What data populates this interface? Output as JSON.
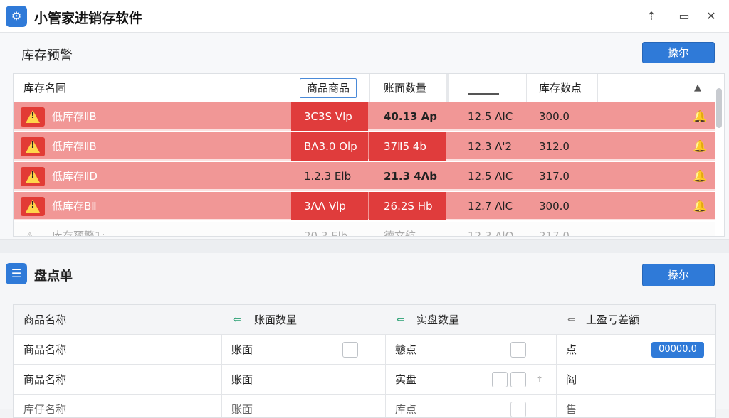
{
  "app": {
    "title": "小管家进销存软件",
    "icon": "app-logo-icon"
  },
  "window_controls": [
    "pin-icon",
    "restore-icon",
    "close-icon"
  ],
  "alert_panel": {
    "title": "库存预警",
    "button_label": "搡尔",
    "columns": [
      "库存名固",
      "商品商品",
      "账面数量",
      "库存数点"
    ],
    "rows": [
      {
        "name": "低库存ⅡB",
        "c1": "3C3S Vlp",
        "c2": "40.13 Ap",
        "c3": "12.5 ΛIC",
        "c4": "300.0"
      },
      {
        "name": "低库存ⅡB",
        "c1": "BΛ3.0 Olp",
        "c2": "37Ⅱ5 4b",
        "c3": "12.3 Λ'2",
        "c4": "312.0"
      },
      {
        "name": "低库存ⅡD",
        "c1": "1.2.3 Elb",
        "c2": "21.3 4Λb",
        "c3": "12.5 ΛIC",
        "c4": "317.0"
      },
      {
        "name": "低库存BⅡ",
        "c1": "3ΛΛ Vlp",
        "c2": "26.2S Hb",
        "c3": "12.7 ΛlC",
        "c4": "300.0"
      },
      {
        "name": "库存预警1:",
        "c1": "20.3 Elb",
        "c2": "德文航",
        "c3": "12.3 ΛlO",
        "c4": "217.0"
      }
    ]
  },
  "count_panel": {
    "title": "盘点单",
    "button_label": "搡尔",
    "columns": [
      "商品名称",
      "账面数量",
      "实盘数量",
      "丄盈亏差额"
    ],
    "rows": [
      {
        "name": "商品名称",
        "c1": "账面",
        "c2": "戇点",
        "c3": "点",
        "value": "00000.0"
      },
      {
        "name": "商品名称",
        "c1": "账面",
        "c2": "实盘",
        "c3": "阎"
      },
      {
        "name": "库仔名称",
        "c1": "账面",
        "c2": "库点",
        "c3": "售"
      }
    ]
  }
}
